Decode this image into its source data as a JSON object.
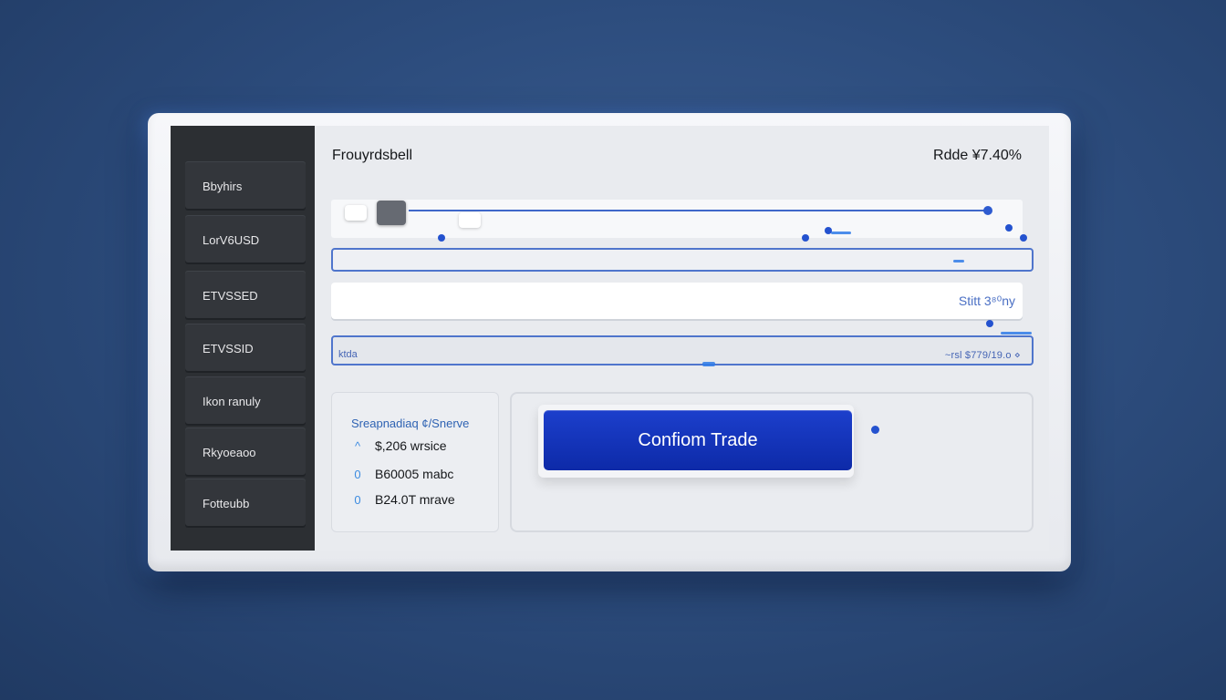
{
  "sidebar": {
    "items": [
      {
        "label": "Bbyhirs"
      },
      {
        "label": "LorV6USD"
      },
      {
        "label": "ETVSSED"
      },
      {
        "label": "ETVSSID"
      },
      {
        "label": "Ikon ranuly"
      },
      {
        "label": "Rkyoeaoo"
      },
      {
        "label": "Fotteubb"
      }
    ]
  },
  "header": {
    "title": "Frouyrdsbell",
    "rate": "Rdde ¥7.40%"
  },
  "form": {
    "amount_value": "Stitt 3⁸⁰ny",
    "field3_label": "ktda",
    "field3_value": "~rsl $779/19.o ⋄"
  },
  "summary": {
    "title": "Sreapnadiaq ¢/Snerve",
    "rows": [
      {
        "icon": "^",
        "text": "$,206 wrsice"
      },
      {
        "icon": "0",
        "text": "B60005 mabc"
      },
      {
        "icon": "0",
        "text": "B24.0T mrave"
      }
    ]
  },
  "actions": {
    "confirm_label": "Confiom Trade"
  },
  "colors": {
    "accent": "#1c3fcc",
    "sidebar_bg": "#2c2f33",
    "link_blue": "#3566c4"
  }
}
